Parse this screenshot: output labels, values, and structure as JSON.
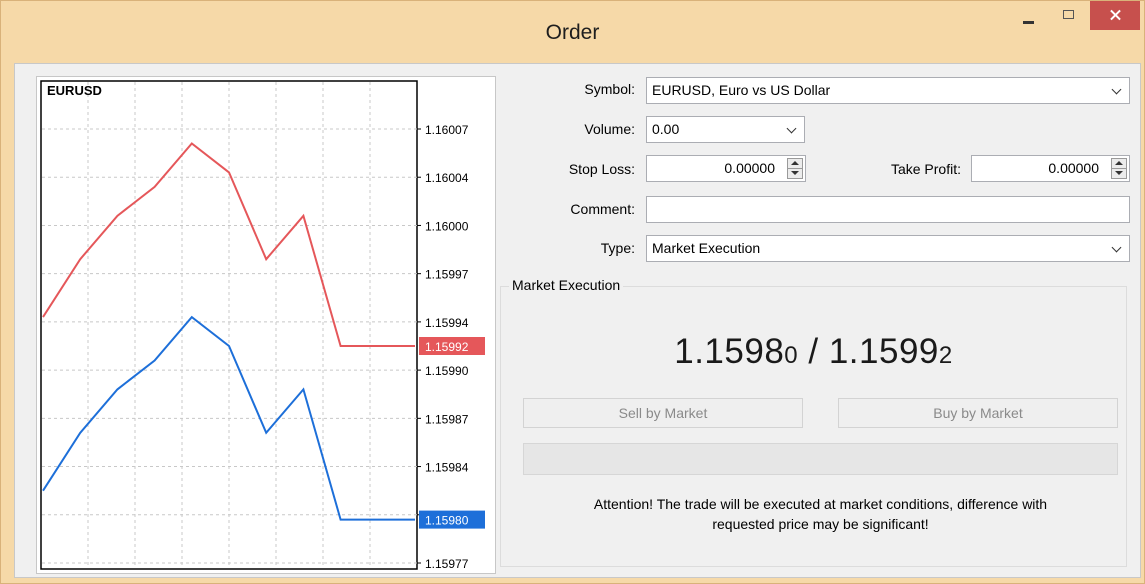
{
  "window": {
    "title": "Order"
  },
  "chart": {
    "symbol": "EURUSD",
    "price_labels": [
      "1.16007",
      "1.16004",
      "1.16000",
      "1.15997",
      "1.15994",
      "1.15990",
      "1.15987",
      "1.15984",
      "1.15980",
      "1.15977"
    ],
    "ask_tag": "1.15992",
    "bid_tag": "1.15980",
    "ask_color": "#e5575a",
    "bid_color": "#1d6fd9"
  },
  "chart_data": {
    "type": "line",
    "title": "",
    "ylim": [
      1.15977,
      1.16007
    ],
    "series": [
      {
        "values": [
          1.15994,
          1.15998,
          1.16001,
          1.16003,
          1.16006,
          1.16004,
          1.15998,
          1.16001,
          1.15992,
          1.15992,
          1.15992
        ]
      },
      {
        "values": [
          1.15982,
          1.15986,
          1.15989,
          1.15991,
          1.15994,
          1.15992,
          1.15986,
          1.15989,
          1.1598,
          1.1598,
          1.1598
        ]
      }
    ]
  },
  "form": {
    "symbol_label": "Symbol:",
    "symbol_value": "EURUSD, Euro vs US Dollar",
    "volume_label": "Volume:",
    "volume_value": "0.00",
    "stoploss_label": "Stop Loss:",
    "stoploss_value": "0.00000",
    "takeprofit_label": "Take Profit:",
    "takeprofit_value": "0.00000",
    "comment_label": "Comment:",
    "comment_value": "",
    "type_label": "Type:",
    "type_value": "Market Execution"
  },
  "execution": {
    "group_title": "Market Execution",
    "bid_main": "1.1598",
    "bid_small": "0",
    "separator": " / ",
    "ask_main": "1.1599",
    "ask_small": "2",
    "sell_label": "Sell by Market",
    "buy_label": "Buy by Market",
    "attention_line1": "Attention! The trade will be executed at market conditions, difference with",
    "attention_line2": "requested price may be significant!"
  }
}
